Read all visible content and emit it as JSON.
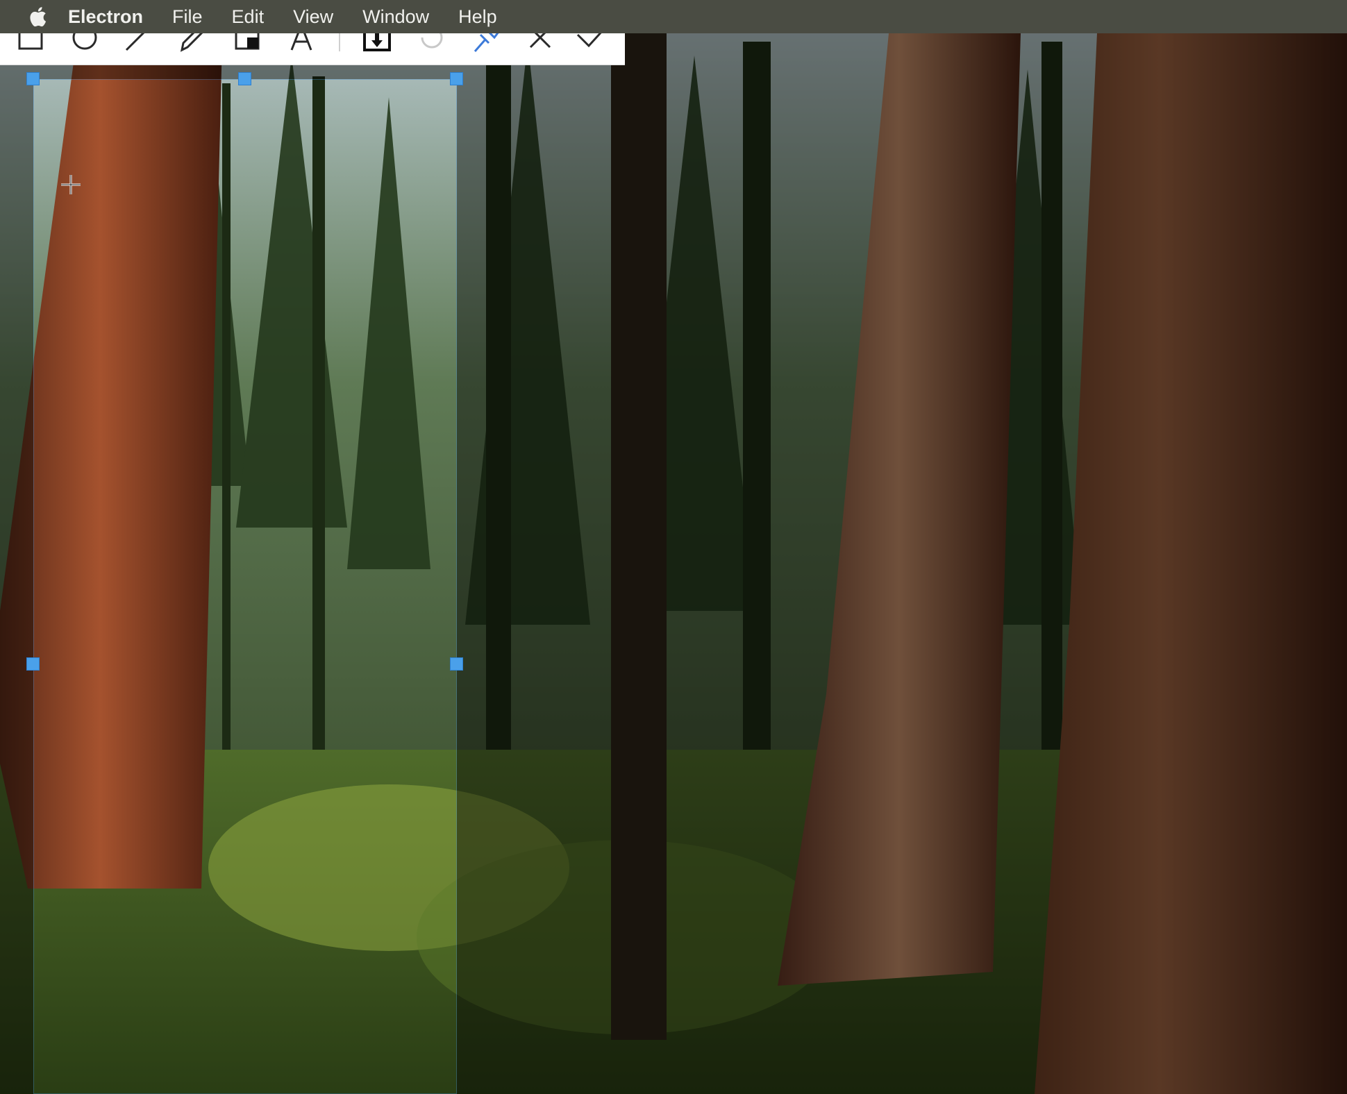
{
  "menubar": {
    "apple_icon": "apple-logo-icon",
    "app_name": "Electron",
    "items": [
      "File",
      "Edit",
      "View",
      "Window",
      "Help"
    ]
  },
  "toolbar": {
    "tools": [
      {
        "id": "rectangle",
        "icon": "rectangle-icon"
      },
      {
        "id": "ellipse",
        "icon": "ellipse-icon"
      },
      {
        "id": "arrow",
        "icon": "arrow-icon"
      },
      {
        "id": "pen",
        "icon": "pen-icon"
      },
      {
        "id": "mosaic",
        "icon": "mosaic-icon"
      },
      {
        "id": "text",
        "icon": "text-icon"
      },
      {
        "id": "save",
        "icon": "download-icon"
      },
      {
        "id": "undo",
        "icon": "undo-icon"
      },
      {
        "id": "pin",
        "icon": "pin-icon"
      },
      {
        "id": "cancel",
        "icon": "close-icon"
      },
      {
        "id": "confirm",
        "icon": "check-icon"
      }
    ],
    "colors": {
      "pin_active": "#3c7ad9",
      "undo_disabled": "#c8c8c8",
      "icon_default": "#2a2a2a"
    }
  },
  "selection": {
    "handle_color": "#4aa0ea",
    "cursor_icon": "crosshair-icon"
  }
}
